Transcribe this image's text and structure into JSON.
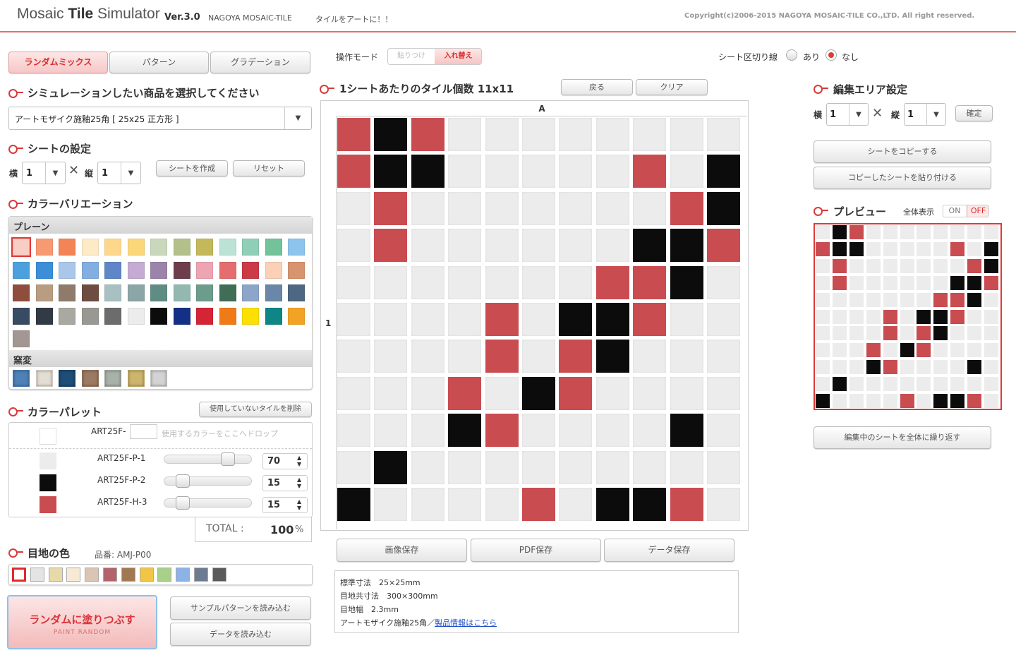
{
  "header": {
    "title_a": "Mosaic ",
    "title_b": "Tile",
    "title_c": " Simulator",
    "version": "Ver.3.0",
    "brand": "NAGOYA MOSAIC-TILE",
    "tagline": "タイルをアートに！！",
    "copyright": "Copyright(c)2006-2015 NAGOYA MOSAIC-TILE CO.,LTD. All right reserved."
  },
  "tabs": [
    "ランダムミックス",
    "パターン",
    "グラデーション"
  ],
  "product": {
    "heading": "シミュレーションしたい商品を選択してください",
    "selected": "アートモザイク施釉25角 [ 25x25 正方形 ]"
  },
  "sheet": {
    "heading": "シートの設定",
    "yoko": "横",
    "tate": "縦",
    "yoko_val": "1",
    "tate_val": "1",
    "create": "シートを作成",
    "reset": "リセット"
  },
  "variation": {
    "heading": "カラーバリエーション",
    "plain_label": "プレーン",
    "yohen_label": "窯変",
    "plain": [
      "#f7cdc4",
      "#f79a72",
      "#f28455",
      "#fdebc7",
      "#fdd88c",
      "#fbd77a",
      "#c9d7bd",
      "#b3c089",
      "#c3b85a",
      "#bce2d6",
      "#8fcfb8",
      "#73c39a",
      "#8cc4ed",
      "#4ba1de",
      "#3a8fd8",
      "#a9c7ea",
      "#82aee2",
      "#5f86c7",
      "#c5aad3",
      "#9b83aa",
      "#6e3e4c",
      "#eea4b2",
      "#e56d6d",
      "#cb3a46",
      "#fcd0b6",
      "#d8936f",
      "#8f4e3c",
      "#b99d82",
      "#8e7b6b",
      "#6e4c40",
      "#a8c0c2",
      "#8aa6a6",
      "#5f8d86",
      "#92b8af",
      "#6c9c8b",
      "#3f6d55",
      "#8ba6c9",
      "#6a86a8",
      "#4e6883",
      "#394b62",
      "#323a45",
      "#a9a9a2",
      "#999892",
      "#6c6c6c",
      "#ececec",
      "#0c0c0c",
      "#142f86",
      "#d42435",
      "#f07b16",
      "#fbe000",
      "#0f8585",
      "#f2a324",
      "#a39693"
    ],
    "yohen": [
      "#4f80b8",
      "#e3ddd4",
      "#1e4e77",
      "#9c7a62",
      "#a9b2a8",
      "#cdb56e",
      "#d3d3d3"
    ]
  },
  "palette": {
    "heading": "カラーパレット",
    "delete_btn": "使用していないタイルを削除",
    "drop_prefix": "ART25F-",
    "drop_hint": "使用するカラーをここへドロップ",
    "items": [
      {
        "code": "ART25F-P-1",
        "color": "#ececec",
        "percent": "70",
        "level": 0.7
      },
      {
        "code": "ART25F-P-2",
        "color": "#0c0c0c",
        "percent": "15",
        "level": 0.15
      },
      {
        "code": "ART25F-H-3",
        "color": "#c94c51",
        "percent": "15",
        "level": 0.15
      }
    ],
    "total_label": "TOTAL :",
    "total_value": "100",
    "total_unit": "%"
  },
  "joint": {
    "heading": "目地の色",
    "code_label": "品番: AMJ-P00",
    "colors": [
      "#ffffff",
      "#e4e4e4",
      "#e7d9a8",
      "#f7e9d6",
      "#dcc4b4",
      "#b3636a",
      "#a27852",
      "#f2c645",
      "#a8d08a",
      "#8cb2e6",
      "#6c7b90",
      "#5a5a5a"
    ]
  },
  "random": {
    "title": "ランダムに塗りつぶす",
    "sub": "PAINT RANDOM"
  },
  "load": {
    "sample": "サンプルパターンを読み込む",
    "data": "データを読み込む"
  },
  "mode": {
    "label": "操作モード",
    "paint": "貼りつけ",
    "swap": "入れ替え"
  },
  "divider": {
    "label": "シート区切り線",
    "on": "あり",
    "off": "なし"
  },
  "grid": {
    "heading": "1シートあたりのタイル個数",
    "count": "11x11",
    "back": "戻る",
    "clear": "クリア",
    "col_label": "A",
    "row_label": "1",
    "rows": [
      "RBRWWWWWWWW",
      "RBBWWWWWRWB",
      "WRWWWWWWWRB",
      "WRWWWWWWBBR",
      "WWWWWWWRRBW",
      "WWWWRWBBRWW",
      "WWWWRWRBWWW",
      "WWWRWBRWWWW",
      "WWWBRWWWWBW",
      "WBWWWWWWWWW",
      "BWWWWRWBBRW"
    ]
  },
  "save": {
    "image": "画像保存",
    "pdf": "PDF保存",
    "data": "データ保存"
  },
  "info": {
    "line1": "標準寸法　25×25mm",
    "line2": "目地共寸法　300×300mm",
    "line3": "目地幅　2.3mm",
    "line4_a": "アートモザイク施釉25角／",
    "line4_link": "製品情報はこちら"
  },
  "edit": {
    "heading": "編集エリア設定",
    "yoko": "横",
    "tate": "縦",
    "yoko_val": "1",
    "tate_val": "1",
    "confirm": "確定",
    "copy": "シートをコピーする",
    "paste": "コピーしたシートを貼り付ける"
  },
  "preview": {
    "heading": "プレビュー",
    "full_label": "全体表示",
    "on": "ON",
    "off": "OFF",
    "repeat": "編集中のシートを全体に繰り返す",
    "rows": [
      "WBRWWWWWWWW",
      "RBBWWWWWRWB",
      "WRWWWWWWWRB",
      "WRWWWWWWBBR",
      "WWWWWWWRRBW",
      "WWWWRWBBRWW",
      "WWWWRWRBWWW",
      "WWWRWBRWWWW",
      "WWWBRWWWWBW",
      "WBWWWWWWWWW",
      "BWWWWRWBBRW"
    ]
  },
  "colors": {
    "accent": "#d93a3a",
    "red_tile": "#c94c51",
    "black_tile": "#0c0c0c",
    "white_tile": "#ececec"
  }
}
